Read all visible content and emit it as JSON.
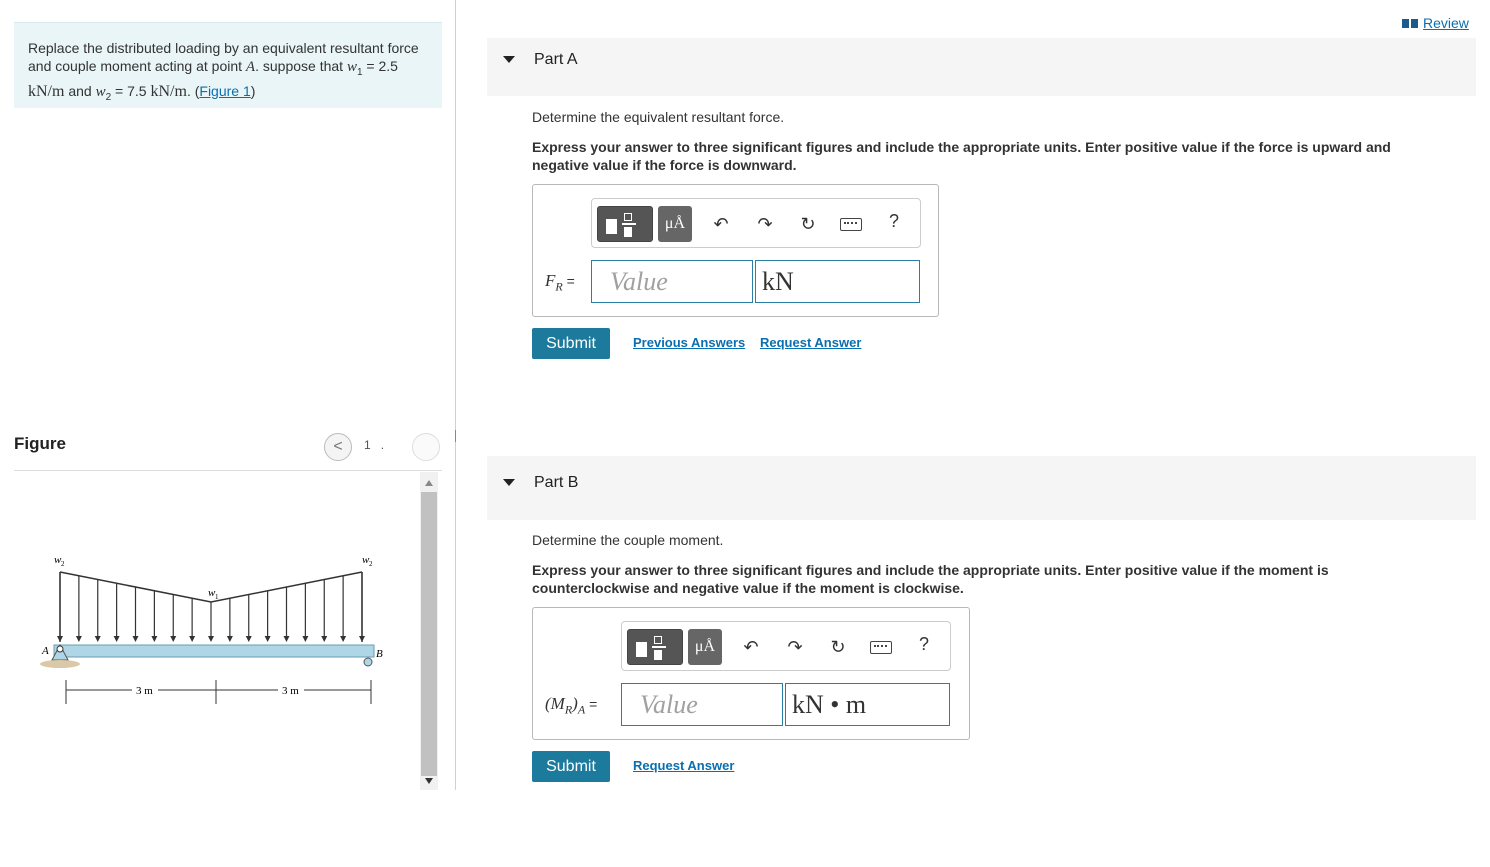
{
  "problem": {
    "text_1": "Replace the distributed loading by an equivalent resultant force and couple moment acting at point ",
    "point": "A",
    "text_2": ". suppose that ",
    "w1_sym": "w",
    "w1_sub": "1",
    "w1_eq": " = 2.5 ",
    "w1_unit": "kN/m",
    "and": " and ",
    "w2_sym": "w",
    "w2_sub": "2",
    "w2_eq": " = 7.5 ",
    "w2_unit": "kN/m",
    "text_3": ". (",
    "figure_link": "Figure 1",
    "text_4": ")"
  },
  "figure": {
    "title": "Figure",
    "prev_icon": "chevron-left-icon",
    "prev_glyph": "<",
    "pager": "1",
    "pager_sep": ".",
    "next_glyph": ">",
    "labels": {
      "w2_left": "w",
      "w2_left_sub": "2",
      "w1": "w",
      "w1_sub": "1",
      "w2_right": "w",
      "w2_right_sub": "2",
      "A": "A",
      "B": "B",
      "dim1": "3 m",
      "dim2": "3 m"
    }
  },
  "review": {
    "label": "Review",
    "icon": "book-icon"
  },
  "part_a": {
    "title": "Part A",
    "question": "Determine the equivalent resultant force.",
    "instructions": "Express your answer to three significant figures and include the appropriate units. Enter positive value if the force is upward and negative value if the force is downward.",
    "var": "F",
    "var_sub": "R",
    "eq": " =",
    "value_placeholder": "Value",
    "unit_value": "kN",
    "submit": "Submit",
    "previous_answers": "Previous Answers",
    "request_answer": "Request Answer",
    "toolbar": {
      "mu": "μÅ",
      "help": "?"
    }
  },
  "part_b": {
    "title": "Part B",
    "question": "Determine the couple moment.",
    "instructions": "Express your answer to three significant figures and include the appropriate units. Enter positive value if the moment is counterclockwise and negative value if the moment is clockwise.",
    "var_open": "(M",
    "var_sub": "R",
    "var_close": ")",
    "var_sub2": "A",
    "eq": " =",
    "value_placeholder": "Value",
    "unit_value": "kN • m",
    "submit": "Submit",
    "request_answer": "Request Answer",
    "toolbar": {
      "mu": "μÅ",
      "help": "?"
    }
  },
  "colors": {
    "accent": "#1c7a9c",
    "link": "#0a6fb0",
    "beam": "#aed6e6",
    "problem_bg": "#e9f5f7"
  }
}
